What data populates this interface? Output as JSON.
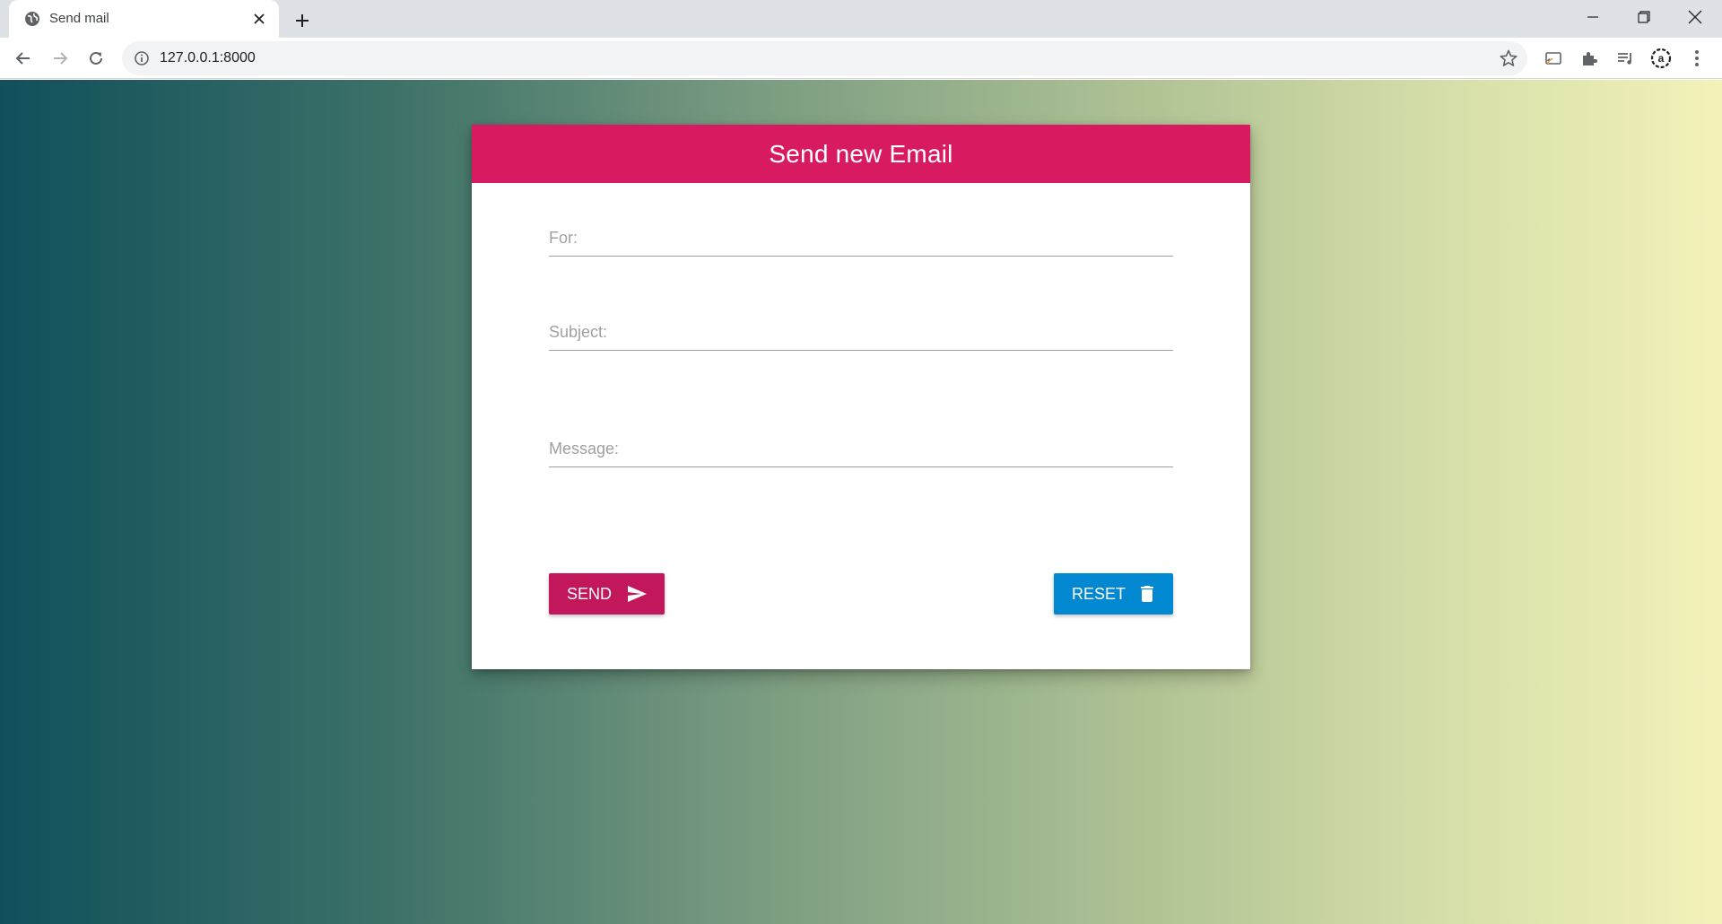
{
  "browser": {
    "tab_title": "Send mail",
    "url": "127.0.0.1:8000",
    "icons": {
      "favicon": "globe-icon",
      "tab_close": "close-icon",
      "new_tab": "plus-icon",
      "minimize": "minimize-icon",
      "restore": "restore-icon",
      "close_window": "close-icon",
      "back": "back-arrow-icon",
      "forward": "forward-arrow-icon",
      "reload": "reload-icon",
      "site_info": "info-icon",
      "bookmark": "star-icon",
      "cast": "cast-icon",
      "extensions": "puzzle-icon",
      "media": "media-queue-icon",
      "profile": "profile-icon",
      "menu": "kebab-menu-icon"
    }
  },
  "form": {
    "title": "Send new Email",
    "fields": {
      "for": {
        "placeholder": "For:",
        "value": ""
      },
      "subject": {
        "placeholder": "Subject:",
        "value": ""
      },
      "message": {
        "placeholder": "Message:",
        "value": ""
      }
    },
    "send_label": "SEND",
    "reset_label": "RESET"
  },
  "colors": {
    "header": "#d81b60",
    "send_button": "#c2185b",
    "reset_button": "#0288d1",
    "gradient_start": "#114f5b",
    "gradient_end": "#f3f2b9"
  }
}
